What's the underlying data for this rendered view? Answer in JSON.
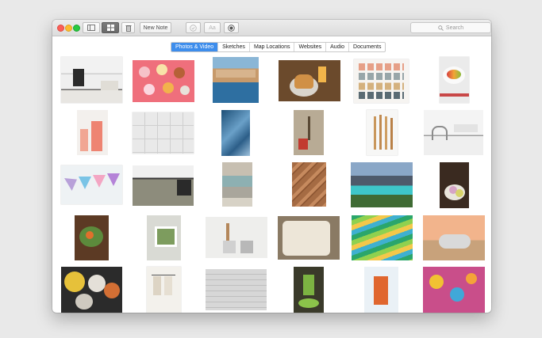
{
  "toolbar": {
    "new_note_label": "New Note",
    "font_label": "Aa",
    "search_placeholder": "Search"
  },
  "tabs": [
    {
      "label": "Photos & Video",
      "selected": true
    },
    {
      "label": "Sketches",
      "selected": false
    },
    {
      "label": "Map Locations",
      "selected": false
    },
    {
      "label": "Websites",
      "selected": false
    },
    {
      "label": "Audio",
      "selected": false
    },
    {
      "label": "Documents",
      "selected": false
    }
  ],
  "colors": {
    "accent": "#3d8dec",
    "close": "#fc5f57",
    "minimize": "#fdbc2e",
    "zoom": "#29c940"
  },
  "icons": [
    "sidebar-toggle-icon",
    "grid-view-icon",
    "trash-icon",
    "checklist-icon",
    "font-icon",
    "media-icon",
    "magnifier-icon"
  ],
  "photos": [
    "kitchen",
    "donuts",
    "coastal-town",
    "burger",
    "paint-swatches",
    "fruit-bowl",
    "drinks",
    "tiles",
    "blue-fabric",
    "potted-branches",
    "wooden-spoons",
    "sink",
    "paper-bunting",
    "kitchen-counter",
    "stone-samples",
    "wood-planks",
    "lake-mountains",
    "cookies",
    "salad-table",
    "window",
    "kitchen-utensils",
    "lace-cloth",
    "yarn-stripes",
    "airstream-trailer",
    "yarn-spools",
    "hanging-cloths",
    "white-bricks",
    "green-juice",
    "sangria",
    "fruit-tablecloth"
  ]
}
